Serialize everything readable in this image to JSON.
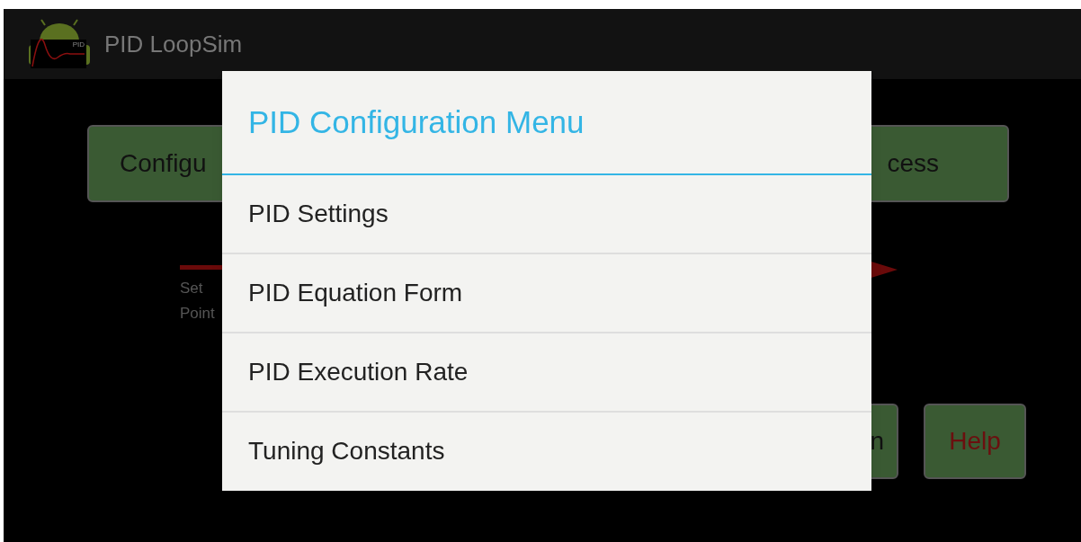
{
  "app_bar": {
    "icon_label": "PID",
    "title": "PID LoopSim"
  },
  "top_buttons": [
    "Configu",
    "cess"
  ],
  "setpoint_label": [
    "Set",
    "Point"
  ],
  "bottom_buttons": [
    {
      "label": "n",
      "kind": "normal"
    },
    {
      "label": "Help",
      "kind": "help"
    }
  ],
  "dialog": {
    "title": "PID Configuration Menu",
    "items": [
      "PID Settings",
      "PID Equation Form",
      "PID Execution Rate",
      "Tuning Constants"
    ]
  }
}
